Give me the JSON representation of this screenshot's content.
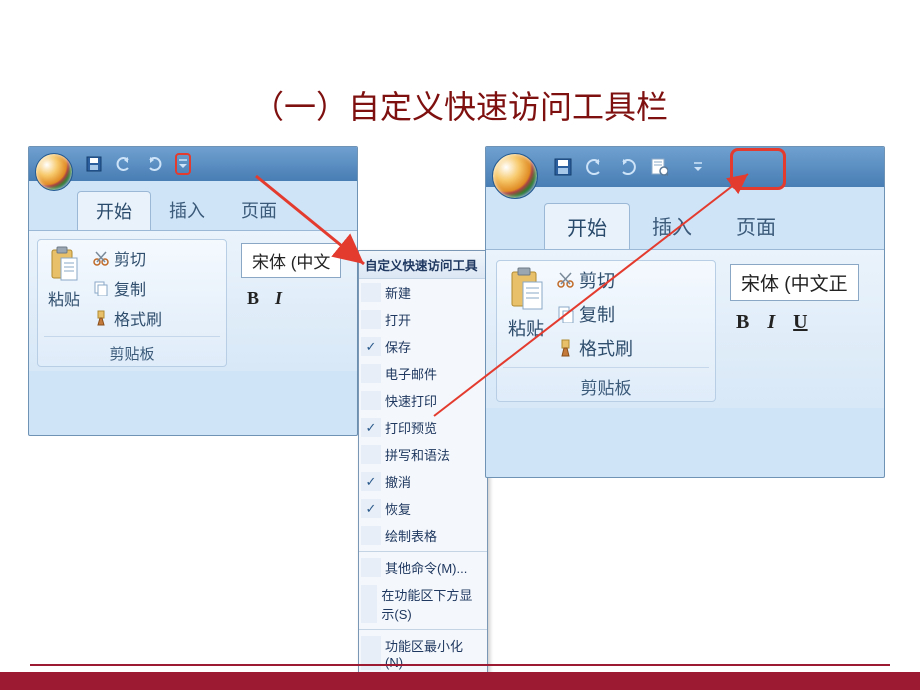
{
  "title": "（一）自定义快速访问工具栏",
  "left_window": {
    "tabs": {
      "home": "开始",
      "insert": "插入",
      "layout": "页面"
    },
    "clipboard": {
      "paste": "粘贴",
      "cut": "剪切",
      "copy": "复制",
      "format_painter": "格式刷",
      "group_label": "剪贴板"
    },
    "font": {
      "combo": "宋体 (中文",
      "b": "B",
      "i": "I"
    }
  },
  "right_window": {
    "tabs": {
      "home": "开始",
      "insert": "插入",
      "layout": "页面"
    },
    "clipboard": {
      "paste": "粘贴",
      "cut": "剪切",
      "copy": "复制",
      "format_painter": "格式刷",
      "group_label": "剪贴板"
    },
    "font": {
      "combo": "宋体 (中文正",
      "b": "B",
      "i": "I",
      "u": "U"
    }
  },
  "dropdown": {
    "title": "自定义快速访问工具",
    "items": [
      {
        "label": "新建",
        "checked": false
      },
      {
        "label": "打开",
        "checked": false
      },
      {
        "label": "保存",
        "checked": true
      },
      {
        "label": "电子邮件",
        "checked": false
      },
      {
        "label": "快速打印",
        "checked": false
      },
      {
        "label": "打印预览",
        "checked": true
      },
      {
        "label": "拼写和语法",
        "checked": false
      },
      {
        "label": "撤消",
        "checked": true
      },
      {
        "label": "恢复",
        "checked": true
      },
      {
        "label": "绘制表格",
        "checked": false
      }
    ],
    "more_commands": "其他命令(M)...",
    "show_below": "在功能区下方显示(S)",
    "minimize": "功能区最小化(N)"
  }
}
